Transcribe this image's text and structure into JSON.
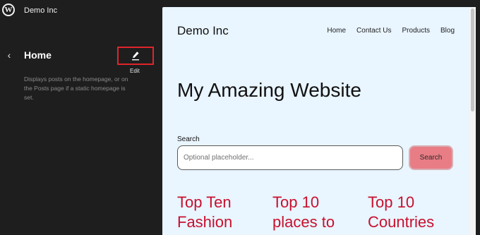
{
  "topbar": {
    "logo_icon": "wordpress-logo-icon",
    "logo_glyph": "W",
    "site_name": "Demo Inc"
  },
  "panel": {
    "back_icon": "chevron-left-icon",
    "back_glyph": "‹",
    "title": "Home",
    "edit_icon": "pencil-icon",
    "edit_tooltip": "Edit",
    "description": "Displays posts on the homepage, or on the Posts page if a static homepage is set.",
    "highlight_color": "#e0242b"
  },
  "preview": {
    "site_title": "Demo Inc",
    "nav": [
      "Home",
      "Contact Us",
      "Products",
      "Blog"
    ],
    "heading": "My Amazing Website",
    "search": {
      "label": "Search",
      "value": "",
      "placeholder": "Optional placeholder...",
      "button_label": "Search"
    },
    "posts": [
      "Top Ten Fashion",
      "Top 10 places to",
      "Top 10 Countries"
    ],
    "colors": {
      "background": "#e9f5ff",
      "post_title": "#c8102e",
      "search_button": "#e87d85"
    }
  }
}
